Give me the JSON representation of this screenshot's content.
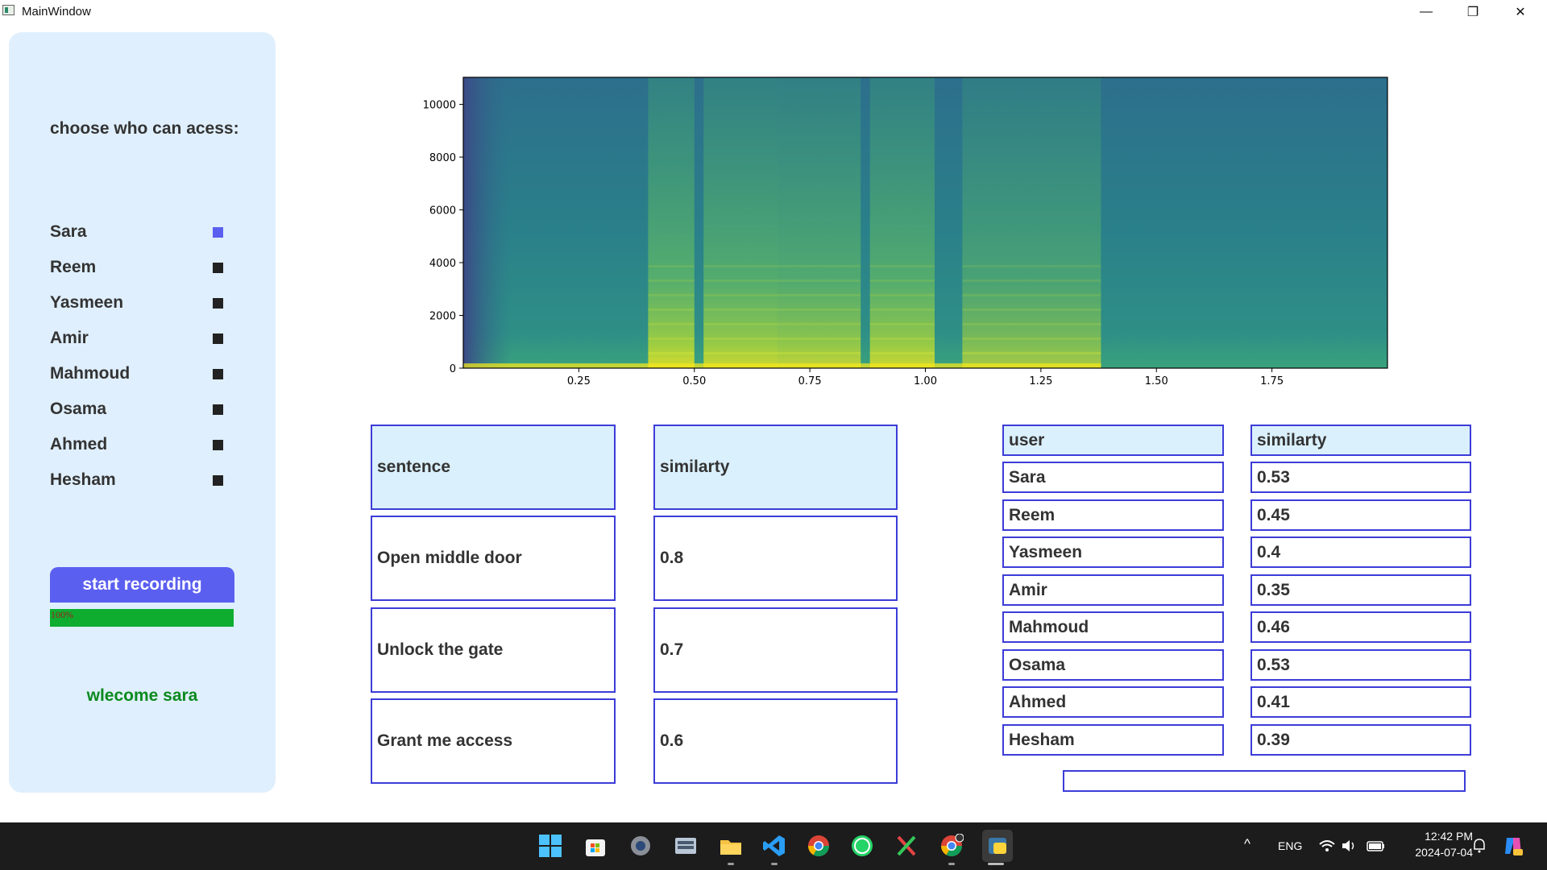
{
  "window": {
    "title": "MainWindow",
    "minimize_glyph": "—",
    "maximize_glyph": "❐",
    "close_glyph": "✕"
  },
  "sidebar": {
    "heading": "choose who can acess:",
    "users": [
      {
        "name": "Sara",
        "checked": true
      },
      {
        "name": "Reem",
        "checked": false
      },
      {
        "name": "Yasmeen",
        "checked": false
      },
      {
        "name": "Amir",
        "checked": false
      },
      {
        "name": "Mahmoud",
        "checked": false
      },
      {
        "name": "Osama",
        "checked": false
      },
      {
        "name": "Ahmed",
        "checked": false
      },
      {
        "name": "Hesham",
        "checked": false
      }
    ],
    "record_button": "start recording",
    "progress": {
      "value": 100,
      "label": "100%"
    },
    "welcome": "wlecome sara"
  },
  "chart_data": {
    "type": "heatmap",
    "title": "",
    "xlabel": "",
    "ylabel": "",
    "xlim": [
      0,
      2.0
    ],
    "ylim": [
      0,
      11025
    ],
    "x_ticks": [
      "0.25",
      "0.50",
      "0.75",
      "1.00",
      "1.25",
      "1.50",
      "1.75"
    ],
    "x_tick_values": [
      0.25,
      0.5,
      0.75,
      1.0,
      1.25,
      1.5,
      1.75
    ],
    "y_ticks": [
      "0",
      "2000",
      "4000",
      "6000",
      "8000",
      "10000"
    ],
    "y_tick_values": [
      0,
      2000,
      4000,
      6000,
      8000,
      10000
    ],
    "colormap": "viridis",
    "energy_segments": [
      {
        "start": 0.4,
        "end": 0.5,
        "level": 0.85
      },
      {
        "start": 0.52,
        "end": 0.68,
        "level": 0.8
      },
      {
        "start": 0.68,
        "end": 0.86,
        "level": 0.75
      },
      {
        "start": 0.88,
        "end": 1.02,
        "level": 0.8
      },
      {
        "start": 1.08,
        "end": 1.38,
        "level": 0.6
      }
    ]
  },
  "sentence_table": {
    "headers": [
      "sentence",
      "similarty"
    ],
    "rows": [
      [
        "Open middle door",
        "0.8"
      ],
      [
        "Unlock the gate",
        "0.7"
      ],
      [
        "Grant me access",
        "0.6"
      ]
    ]
  },
  "user_table": {
    "headers": [
      "user",
      "similarty"
    ],
    "rows": [
      [
        "Sara",
        "0.53"
      ],
      [
        "Reem",
        "0.45"
      ],
      [
        "Yasmeen",
        "0.4"
      ],
      [
        "Amir",
        "0.35"
      ],
      [
        "Mahmoud",
        "0.46"
      ],
      [
        "Osama",
        "0.53"
      ],
      [
        "Ahmed",
        "0.41"
      ],
      [
        "Hesham",
        "0.39"
      ]
    ],
    "result_field": ""
  },
  "taskbar": {
    "icons": [
      "windows-start-icon",
      "microsoft-store-icon",
      "settings-icon",
      "keyboard-app-icon",
      "file-explorer-icon",
      "vscode-icon",
      "chrome-icon",
      "whatsapp-icon",
      "snipping-tool-icon",
      "chrome-profile-icon",
      "python-app-icon"
    ],
    "tray_language": "ENG",
    "time": "12:42 PM",
    "date": "2024-07-04",
    "tray_chevron": "^"
  },
  "colors": {
    "accent": "#5b5ff0",
    "panel": "#dfeffd",
    "border": "#3c3cd8",
    "header_cell": "#daf0fc",
    "progress": "#0ead30",
    "welcome": "#0b8a1e"
  }
}
